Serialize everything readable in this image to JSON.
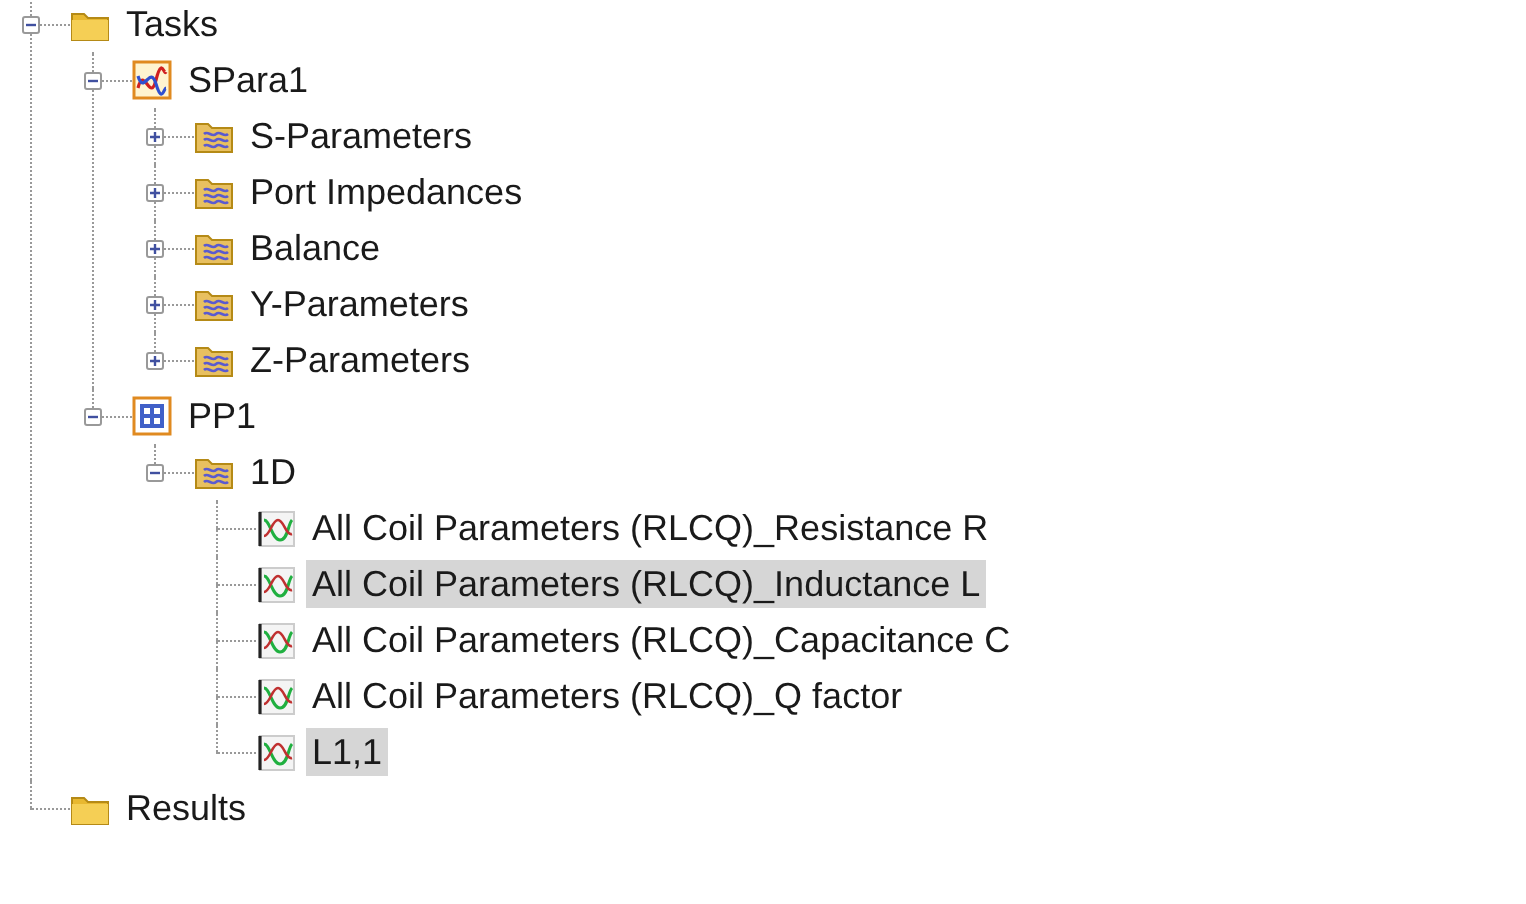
{
  "tree": [
    {
      "label": "Tasks",
      "kind": "folder",
      "expanded": true,
      "selected": false,
      "children": [
        {
          "label": "SPara1",
          "kind": "sparam",
          "expanded": true,
          "selected": false,
          "children": [
            {
              "label": "S-Parameters",
              "kind": "result-folder",
              "expanded": false,
              "selected": false
            },
            {
              "label": "Port Impedances",
              "kind": "result-folder",
              "expanded": false,
              "selected": false
            },
            {
              "label": "Balance",
              "kind": "result-folder",
              "expanded": false,
              "selected": false
            },
            {
              "label": "Y-Parameters",
              "kind": "result-folder",
              "expanded": false,
              "selected": false
            },
            {
              "label": "Z-Parameters",
              "kind": "result-folder",
              "expanded": false,
              "selected": false
            }
          ]
        },
        {
          "label": "PP1",
          "kind": "postprocess",
          "expanded": true,
          "selected": false,
          "children": [
            {
              "label": "1D",
              "kind": "result-folder",
              "expanded": true,
              "selected": false,
              "children": [
                {
                  "label": "All Coil Parameters (RLCQ)_Resistance R",
                  "kind": "curve",
                  "selected": false
                },
                {
                  "label": "All Coil Parameters (RLCQ)_Inductance L",
                  "kind": "curve",
                  "selected": true
                },
                {
                  "label": "All Coil Parameters (RLCQ)_Capacitance C",
                  "kind": "curve",
                  "selected": false
                },
                {
                  "label": "All Coil Parameters (RLCQ)_Q factor",
                  "kind": "curve",
                  "selected": false
                },
                {
                  "label": "L1,1",
                  "kind": "curve",
                  "selected": true
                }
              ]
            }
          ]
        }
      ]
    },
    {
      "label": "Results",
      "kind": "folder",
      "selected": false
    }
  ]
}
